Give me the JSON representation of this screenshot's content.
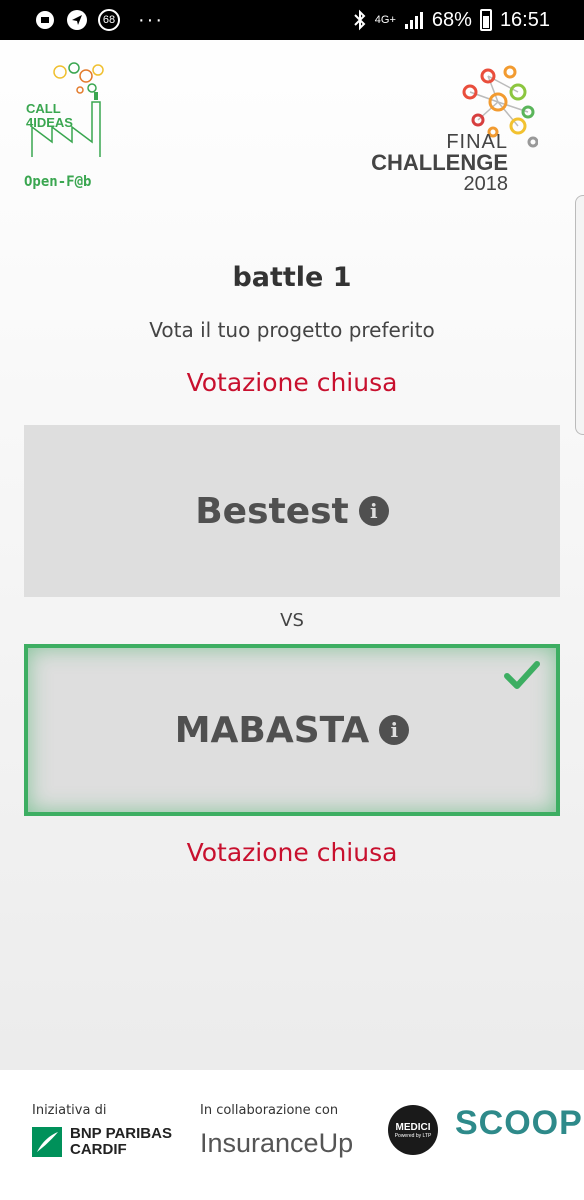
{
  "status_bar": {
    "badge_count": "68",
    "network": "4G+",
    "battery": "68%",
    "time": "16:51",
    "dots": "···"
  },
  "header": {
    "left_logo": {
      "line1": "CALL",
      "line2": "4IDEAS",
      "brand": "Open-F@b"
    },
    "right_logo": {
      "line1": "FINAL",
      "line2": "CHALLENGE",
      "line3": "2018"
    }
  },
  "main": {
    "title": "battle 1",
    "subtitle": "Vota il tuo progetto preferito",
    "status_top": "Votazione chiusa",
    "status_bottom": "Votazione chiusa",
    "vs": "VS",
    "projects": [
      {
        "name": "Bestest",
        "selected": false
      },
      {
        "name": "MABASTA",
        "selected": true
      }
    ],
    "accent_color": "#3dae62",
    "closed_color": "#c8102e"
  },
  "footer": {
    "initiative_label": "Iniziativa di",
    "bnp_line1": "BNP PARIBAS",
    "bnp_line2": "CARDIF",
    "collab_label": "In collaborazione con",
    "insurance_logo": "InsuranceUp",
    "medici_logo": "MEDICI",
    "medici_sub": "Powered by LTP",
    "scoop_logo": "SCOOP"
  }
}
